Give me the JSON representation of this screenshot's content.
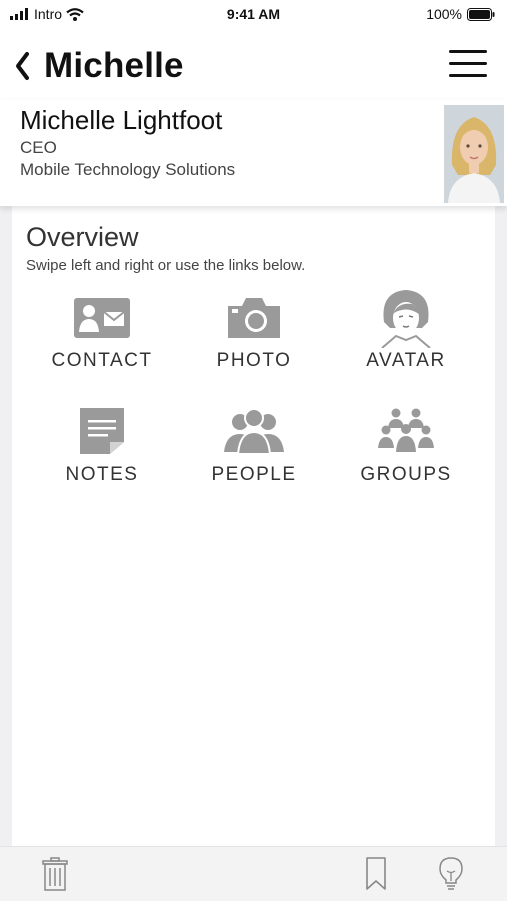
{
  "status_bar": {
    "carrier": "Intro",
    "time": "9:41 AM",
    "battery": "100%",
    "icons": [
      "signal-icon",
      "wifi-icon",
      "battery-icon"
    ]
  },
  "nav": {
    "back_icon": "chevron-left-icon",
    "title": "Michelle",
    "menu_icon": "hamburger-menu-icon"
  },
  "profile": {
    "name": "Michelle Lightfoot",
    "title": "CEO",
    "company": "Mobile Technology Solutions"
  },
  "overview": {
    "heading": "Overview",
    "subtitle": "Swipe left and right or use the links below.",
    "tiles": [
      {
        "label": "CONTACT",
        "icon": "contact-card-icon"
      },
      {
        "label": "PHOTO",
        "icon": "camera-icon"
      },
      {
        "label": "AVATAR",
        "icon": "avatar-face-icon"
      },
      {
        "label": "NOTES",
        "icon": "notes-icon"
      },
      {
        "label": "PEOPLE",
        "icon": "people-icon"
      },
      {
        "label": "GROUPS",
        "icon": "groups-icon"
      }
    ]
  },
  "toolbar": {
    "icons": [
      "trash-icon",
      "bookmark-icon",
      "lightbulb-icon"
    ]
  },
  "colors": {
    "icon_gray": "#9a9a9a",
    "text_dark": "#111111",
    "bar_bg": "#f3f3f4"
  }
}
